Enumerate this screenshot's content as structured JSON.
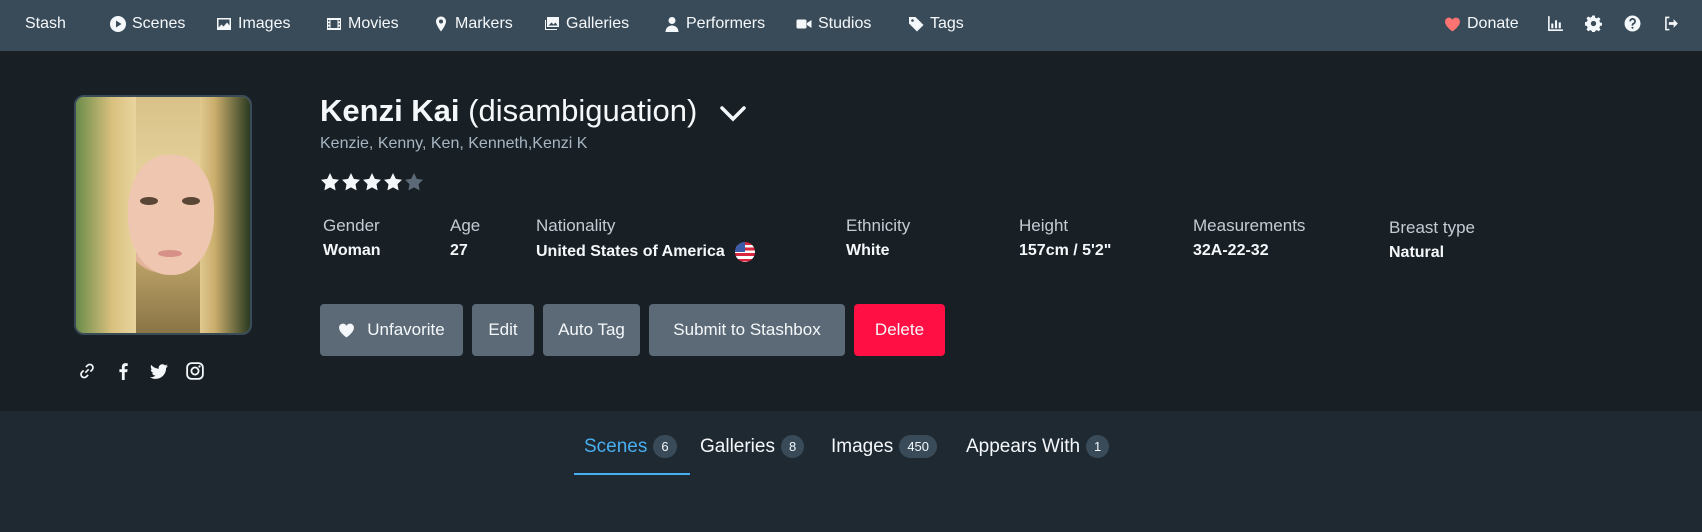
{
  "navbar": {
    "brand": "Stash",
    "items": [
      {
        "label": "Scenes",
        "icon": "play-circle-icon"
      },
      {
        "label": "Images",
        "icon": "image-icon"
      },
      {
        "label": "Movies",
        "icon": "film-icon"
      },
      {
        "label": "Markers",
        "icon": "map-marker-icon"
      },
      {
        "label": "Galleries",
        "icon": "images-icon"
      },
      {
        "label": "Performers",
        "icon": "user-icon"
      },
      {
        "label": "Studios",
        "icon": "video-icon"
      },
      {
        "label": "Tags",
        "icon": "tag-icon"
      }
    ],
    "donate_label": "Donate",
    "right_icons": [
      "stats-chart-icon",
      "settings-gear-icon",
      "help-question-icon",
      "logout-icon"
    ]
  },
  "performer": {
    "name": "Kenzi Kai",
    "disambiguation": "(disambiguation)",
    "aliases": "Kenzie, Kenny, Ken, Kenneth,Kenzi K",
    "rating": 4,
    "rating_max": 5,
    "details": [
      {
        "key": "Gender",
        "value": "Woman"
      },
      {
        "key": "Age",
        "value": "27"
      },
      {
        "key": "Nationality",
        "value": "United States of America"
      },
      {
        "key": "Ethnicity",
        "value": "White"
      },
      {
        "key": "Height",
        "value": "157cm / 5'2\""
      },
      {
        "key": "Measurements",
        "value": "32A-22-32"
      },
      {
        "key": "Breast type",
        "value": "Natural"
      }
    ],
    "link_icons": [
      "link-icon",
      "facebook-icon",
      "twitter-icon",
      "instagram-icon"
    ]
  },
  "actions": {
    "unfavorite": "Unfavorite",
    "edit": "Edit",
    "auto_tag": "Auto Tag",
    "submit": "Submit to Stashbox",
    "delete": "Delete"
  },
  "tabs": [
    {
      "label": "Scenes",
      "count": "6",
      "active": true
    },
    {
      "label": "Galleries",
      "count": "8",
      "active": false
    },
    {
      "label": "Images",
      "count": "450",
      "active": false
    },
    {
      "label": "Appears With",
      "count": "1",
      "active": false
    }
  ],
  "colors": {
    "navbar": "#394b59",
    "header_bg": "#182026",
    "page_bg": "#1f2932",
    "accent": "#48aff0",
    "danger": "#ff0f44",
    "donate_heart": "#ff7373",
    "star_filled": "#f5f8fa",
    "star_empty": "#5c6a77"
  }
}
